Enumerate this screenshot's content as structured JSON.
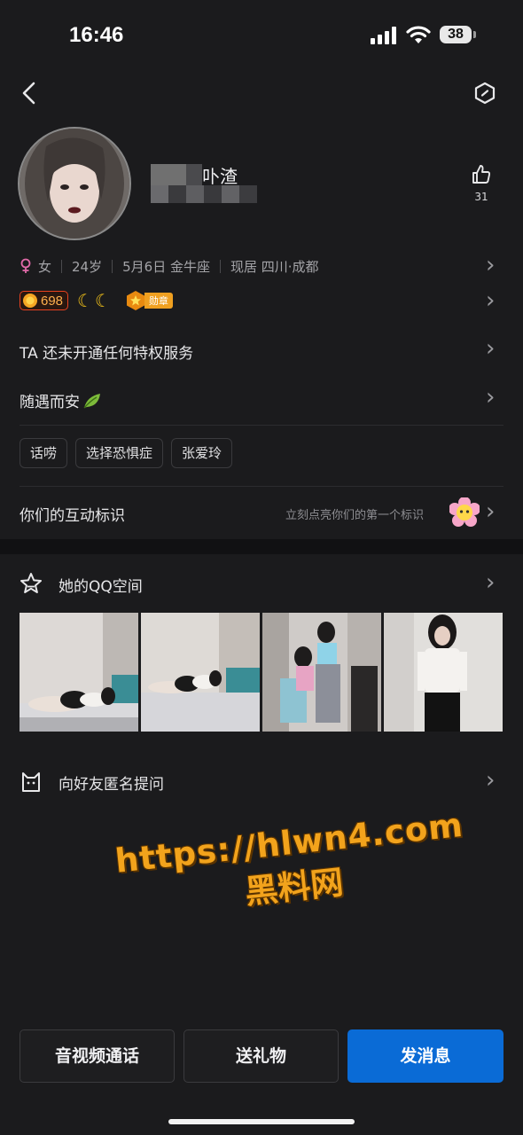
{
  "status_bar": {
    "time": "16:46",
    "battery": "38"
  },
  "profile": {
    "name_suffix": "卟渣",
    "likes": "31",
    "gender": "女",
    "age": "24岁",
    "birthday": "5月6日 金牛座",
    "location": "现居 四川·成都",
    "level_score": "698",
    "medal_label": "勋章"
  },
  "rows": {
    "privilege": "TA 还未开通任何特权服务",
    "signature": "随遇而安"
  },
  "tags": [
    "话唠",
    "选择恐惧症",
    "张爱玲"
  ],
  "interaction": {
    "label": "你们的互动标识",
    "hint": "立刻点亮你们的第一个标识"
  },
  "qzone": {
    "label": "她的QQ空间"
  },
  "anon_question": {
    "label": "向好友匿名提问"
  },
  "watermark": {
    "line1": "https://hlwn4.com",
    "line2": "黑料网"
  },
  "buttons": {
    "call": "音视频通话",
    "gift": "送礼物",
    "message": "发消息"
  },
  "colors": {
    "accent_blue": "#0a6bd6",
    "background": "#1b1b1d",
    "watermark_orange": "#f2a31c"
  }
}
